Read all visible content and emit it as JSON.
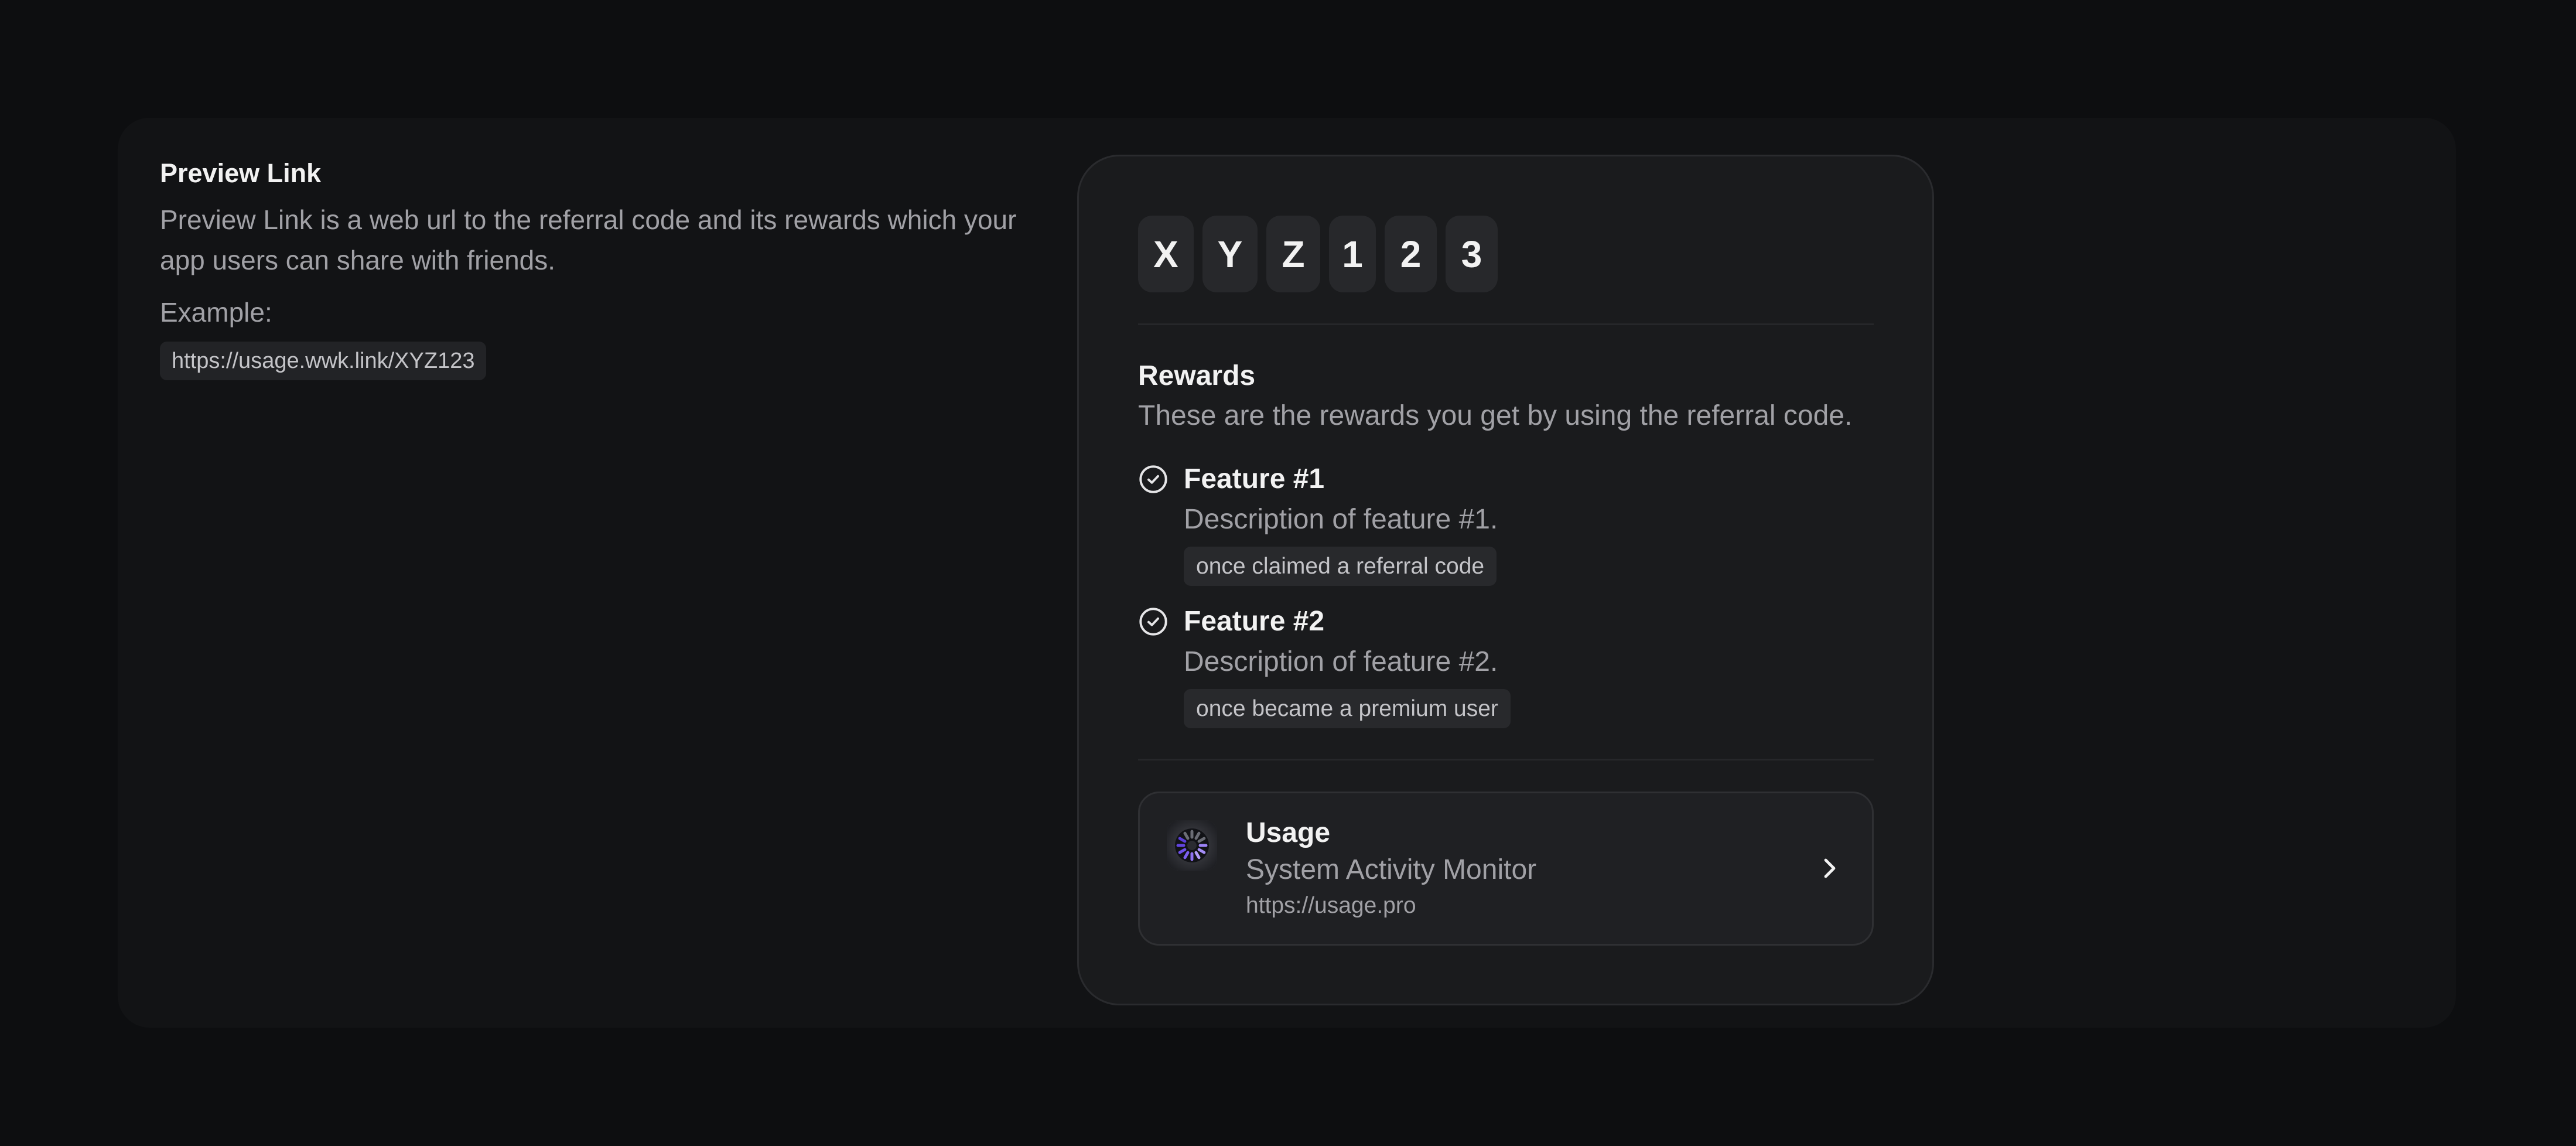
{
  "preview": {
    "title": "Preview Link",
    "description": "Preview Link is a web url to the referral code and its rewards which your app users can share with friends.",
    "example_label": "Example:",
    "example_url": "https://usage.wwk.link/XYZ123"
  },
  "referral_code": {
    "characters": [
      "X",
      "Y",
      "Z",
      "1",
      "2",
      "3"
    ]
  },
  "rewards": {
    "title": "Rewards",
    "subtitle": "These are the rewards you get by using the referral code.",
    "features": [
      {
        "title": "Feature #1",
        "description": "Description of feature #1.",
        "condition": "once claimed a referral code",
        "icon": "check-circle-icon"
      },
      {
        "title": "Feature #2",
        "description": "Description of feature #2.",
        "condition": "once became a premium user",
        "icon": "check-circle-icon"
      }
    ]
  },
  "app": {
    "name": "Usage",
    "description": "System Activity Monitor",
    "url": "https://usage.pro",
    "icon": "usage-app-icon",
    "accent_color": "#8b6cf0"
  }
}
